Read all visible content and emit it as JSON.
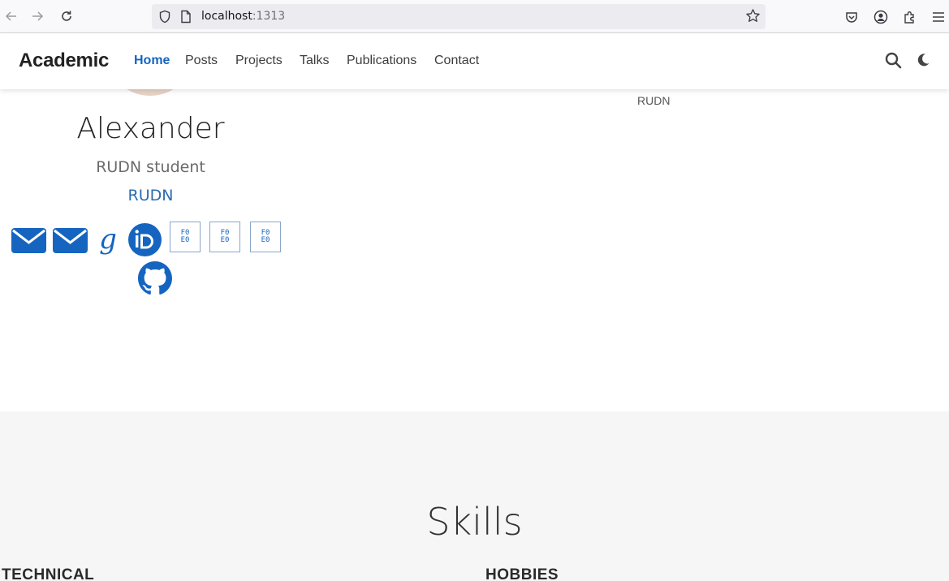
{
  "browser": {
    "url_host": "localhost",
    "url_port": ":1313"
  },
  "nav": {
    "brand": "Academic",
    "items": [
      {
        "label": "Home"
      },
      {
        "label": "Posts"
      },
      {
        "label": "Projects"
      },
      {
        "label": "Talks"
      },
      {
        "label": "Publications"
      },
      {
        "label": "Contact"
      }
    ],
    "accent_color": "#1565c0"
  },
  "profile": {
    "name": "Alexander",
    "role": "RUDN student",
    "organization": "RUDN",
    "right_label": "RUDN",
    "missing_glyph_text": "F0\nE0",
    "social_icons": [
      "envelope-icon",
      "envelope-icon",
      "google-scholar-icon",
      "orcid-icon",
      "missing-glyph-icon",
      "missing-glyph-icon",
      "missing-glyph-icon",
      "github-icon"
    ]
  },
  "skills": {
    "title": "Skills",
    "columns": [
      "TECHNICAL",
      "HOBBIES"
    ]
  }
}
